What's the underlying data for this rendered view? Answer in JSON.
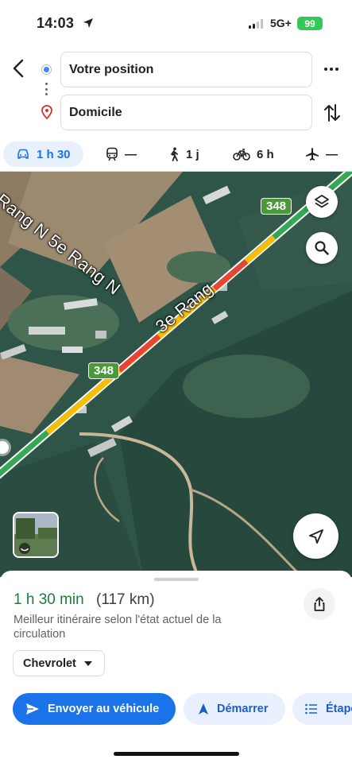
{
  "status_bar": {
    "time": "14:03",
    "network": "5G+",
    "battery": "99"
  },
  "search": {
    "from": "Votre position",
    "to": "Domicile"
  },
  "modes": [
    {
      "name": "car",
      "label": "1 h 30",
      "active": true
    },
    {
      "name": "transit",
      "label": "—"
    },
    {
      "name": "walk",
      "label": "1 j"
    },
    {
      "name": "bike",
      "label": "6 h"
    },
    {
      "name": "flight",
      "label": "—"
    }
  ],
  "map": {
    "labels": [
      "Rang N 5e Rang N",
      "3e Rang"
    ],
    "shields": [
      "348",
      "348"
    ]
  },
  "route": {
    "duration": "1 h 30 min",
    "distance": "(117 km)",
    "description": "Meilleur itinéraire selon l'état actuel de la circulation",
    "vehicle": "Chevrolet"
  },
  "actions": {
    "send": "Envoyer au véhicule",
    "start": "Démarrer",
    "steps": "Étapes"
  },
  "colors": {
    "accent": "#1a73e8",
    "duration_green": "#188038",
    "shield_green": "#4a9a3a"
  }
}
